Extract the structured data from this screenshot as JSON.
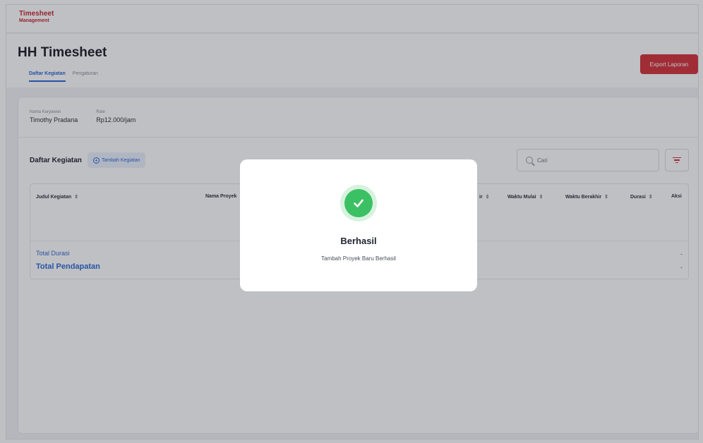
{
  "app": {
    "logo_line1": "Timesheet",
    "logo_line2": "Management"
  },
  "header": {
    "title": "HH Timesheet",
    "tabs": [
      {
        "label": "Daftar Kegiatan"
      },
      {
        "label": "Pengaturan"
      }
    ],
    "export_label": "Export Laporan"
  },
  "employee": {
    "name_label": "Nama Karyawan",
    "name_value": "Timothy Pradana",
    "rate_label": "Rate",
    "rate_value": "Rp12.000/jam"
  },
  "activities": {
    "title": "Daftar Kegiatan",
    "add_label": "Tambah Kegiatan",
    "search_placeholder": "Cari",
    "columns": [
      {
        "label": "Judul Kegiatan",
        "sort": "⇕"
      },
      {
        "label": "Nama Proyek",
        "sort": ""
      },
      {
        "label": "ir",
        "sort": "⇕"
      },
      {
        "label": "Waktu Mulai",
        "sort": "⇕"
      },
      {
        "label": "Waktu Berakhir",
        "sort": "⇕"
      },
      {
        "label": "Durasi",
        "sort": "⇕"
      },
      {
        "label": "Aksi",
        "sort": ""
      }
    ],
    "total_duration_label": "Total Durasi",
    "total_duration_value": "-",
    "total_income_label": "Total Pendapatan",
    "total_income_value": "-"
  },
  "modal": {
    "icon": "check-circle-icon",
    "title": "Berhasil",
    "message": "Tambah Proyek Baru Berhasil"
  },
  "colors": {
    "accent": "#2d6ad6",
    "brand_red": "#d4343c",
    "success": "#3cc064"
  }
}
